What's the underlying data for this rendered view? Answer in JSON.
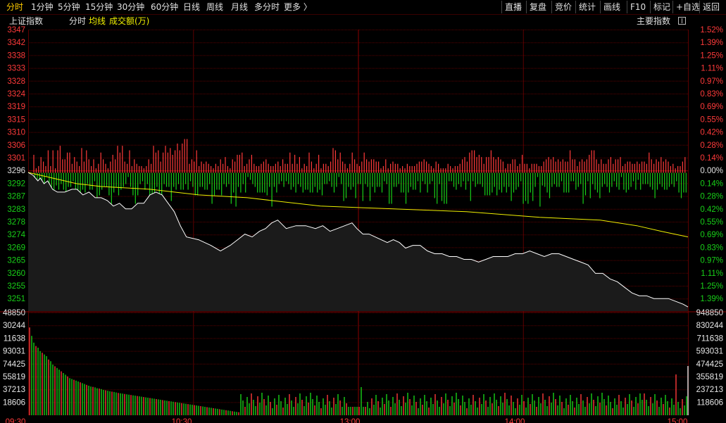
{
  "top_tabs": [
    "分时",
    "1分钟",
    "5分钟",
    "15分钟",
    "30分钟",
    "60分钟",
    "日线",
    "周线",
    "月线",
    "多分时",
    "更多 〉"
  ],
  "active_tab": "分时",
  "right_tabs": [
    "直播",
    "复盘",
    "竞价",
    "统计",
    "画线",
    "F10",
    "标记",
    "+自选",
    "返回"
  ],
  "info": {
    "index_name": "上证指数",
    "mode": "分时",
    "avg_label": "均线",
    "volume_label": "成交额(万)",
    "panel_label": "主要指数"
  },
  "colors": {
    "up": "#ff3a3a",
    "down": "#18d018",
    "flat": "#e0e0e0",
    "avg": "#f0f000",
    "grid": "#5a0000",
    "price": "#ffffff"
  },
  "price_axis": {
    "left_labels": [
      "3347",
      "3342",
      "3338",
      "3333",
      "3328",
      "3324",
      "3319",
      "3315",
      "3310",
      "3306",
      "3301",
      "3296",
      "3292",
      "3287",
      "3283",
      "3278",
      "3274",
      "3269",
      "3265",
      "3260",
      "3255",
      "3251"
    ],
    "right_labels": [
      "1.52%",
      "1.39%",
      "1.25%",
      "1.11%",
      "0.97%",
      "0.83%",
      "0.69%",
      "0.55%",
      "0.42%",
      "0.28%",
      "0.14%",
      "0.00%",
      "0.14%",
      "0.28%",
      "0.42%",
      "0.55%",
      "0.69%",
      "0.83%",
      "0.97%",
      "1.11%",
      "1.25%",
      "1.39%"
    ]
  },
  "volume_axis": {
    "left_labels": [
      "48850",
      "30244",
      "11638",
      "93031",
      "74425",
      "55819",
      "37213",
      "18606"
    ],
    "right_labels": [
      "948850",
      "830244",
      "711638",
      "593031",
      "474425",
      "355819",
      "237213",
      "118606"
    ]
  },
  "time_labels": [
    "09:30",
    "10:30",
    "13:00",
    "14:00",
    "15:00"
  ],
  "chart_data": {
    "type": "line",
    "title": "上证指数",
    "prev_close": 3296,
    "ylim": [
      3251,
      3347
    ],
    "price_points": [
      [
        0,
        3296
      ],
      [
        4,
        3295
      ],
      [
        8,
        3293
      ],
      [
        10,
        3294
      ],
      [
        13,
        3292
      ],
      [
        16,
        3293
      ],
      [
        20,
        3290
      ],
      [
        24,
        3289
      ],
      [
        30,
        3289
      ],
      [
        36,
        3290
      ],
      [
        40,
        3290
      ],
      [
        45,
        3288
      ],
      [
        50,
        3289
      ],
      [
        55,
        3287
      ],
      [
        60,
        3287
      ],
      [
        65,
        3286
      ],
      [
        70,
        3284
      ],
      [
        75,
        3285
      ],
      [
        80,
        3283
      ],
      [
        85,
        3283
      ],
      [
        90,
        3285
      ],
      [
        95,
        3285
      ],
      [
        100,
        3288
      ],
      [
        105,
        3289
      ],
      [
        110,
        3288
      ],
      [
        115,
        3285
      ],
      [
        120,
        3282
      ],
      [
        125,
        3277
      ],
      [
        130,
        3273
      ],
      [
        140,
        3272
      ],
      [
        150,
        3270
      ],
      [
        158,
        3268
      ],
      [
        166,
        3270
      ],
      [
        172,
        3272
      ],
      [
        178,
        3274
      ],
      [
        184,
        3273
      ],
      [
        190,
        3275
      ],
      [
        195,
        3276
      ],
      [
        200,
        3278
      ],
      [
        205,
        3279
      ],
      [
        212,
        3276
      ],
      [
        220,
        3277
      ],
      [
        228,
        3277
      ],
      [
        236,
        3276
      ],
      [
        242,
        3277
      ],
      [
        248,
        3275
      ],
      [
        254,
        3276
      ],
      [
        260,
        3277
      ],
      [
        266,
        3278
      ],
      [
        270,
        3276
      ],
      [
        275,
        3274
      ],
      [
        280,
        3274
      ],
      [
        285,
        3273
      ],
      [
        290,
        3272
      ],
      [
        295,
        3271
      ],
      [
        300,
        3272
      ],
      [
        305,
        3271
      ],
      [
        310,
        3269
      ],
      [
        316,
        3270
      ],
      [
        322,
        3270
      ],
      [
        328,
        3268
      ],
      [
        334,
        3267
      ],
      [
        340,
        3267
      ],
      [
        346,
        3266
      ],
      [
        352,
        3266
      ],
      [
        358,
        3265
      ],
      [
        364,
        3265
      ],
      [
        370,
        3264
      ],
      [
        376,
        3265
      ],
      [
        382,
        3266
      ],
      [
        388,
        3266
      ],
      [
        394,
        3266
      ],
      [
        400,
        3267
      ],
      [
        406,
        3267
      ],
      [
        412,
        3268
      ],
      [
        418,
        3267
      ],
      [
        424,
        3266
      ],
      [
        430,
        3267
      ],
      [
        436,
        3267
      ],
      [
        442,
        3266
      ],
      [
        448,
        3265
      ],
      [
        454,
        3264
      ],
      [
        460,
        3263
      ],
      [
        466,
        3260
      ],
      [
        472,
        3260
      ],
      [
        478,
        3258
      ],
      [
        484,
        3257
      ],
      [
        490,
        3255
      ],
      [
        496,
        3253
      ],
      [
        502,
        3252
      ],
      [
        508,
        3252
      ],
      [
        514,
        3251
      ],
      [
        520,
        3251
      ],
      [
        526,
        3251
      ],
      [
        532,
        3250
      ],
      [
        538,
        3249
      ],
      [
        542,
        3248
      ]
    ],
    "avg_points": [
      [
        0,
        3296
      ],
      [
        20,
        3294
      ],
      [
        40,
        3292
      ],
      [
        60,
        3291
      ],
      [
        100,
        3290
      ],
      [
        140,
        3288
      ],
      [
        180,
        3287
      ],
      [
        240,
        3284
      ],
      [
        300,
        3283
      ],
      [
        360,
        3282
      ],
      [
        420,
        3280
      ],
      [
        470,
        3279
      ],
      [
        500,
        3277
      ],
      [
        520,
        3275
      ],
      [
        542,
        3273
      ]
    ],
    "breadth_bars_top": [
      8,
      2,
      3,
      7,
      5,
      3,
      10,
      3,
      10,
      2,
      10,
      12,
      6,
      6,
      9,
      9,
      4,
      7,
      5,
      3,
      11,
      5,
      10,
      6,
      3,
      6,
      2,
      4,
      9,
      6,
      4,
      2,
      5,
      8,
      6,
      12,
      9,
      12,
      5,
      4,
      10,
      3,
      6,
      4,
      3,
      3,
      2,
      3,
      6,
      4,
      12,
      9,
      10,
      5,
      9,
      12,
      9,
      11,
      8,
      10,
      13,
      10,
      13,
      15,
      15,
      4,
      6,
      5,
      10,
      3,
      5,
      4,
      5,
      4,
      3,
      2,
      4,
      3,
      6,
      4,
      7,
      3,
      2,
      6,
      5,
      8,
      8,
      9,
      3,
      4,
      6,
      8,
      4,
      3,
      3,
      4,
      5,
      6,
      4,
      3,
      3,
      4,
      5,
      3,
      6,
      4,
      4,
      9,
      4,
      8,
      4,
      7,
      2,
      4,
      3,
      9,
      5,
      2,
      4,
      8,
      2,
      4,
      4,
      3,
      5,
      11,
      10,
      6,
      9,
      5,
      4,
      2,
      4,
      9,
      6,
      4,
      3,
      5,
      9,
      6,
      5,
      6,
      6,
      5,
      5,
      2,
      3,
      6,
      2,
      4,
      5,
      4,
      4,
      2,
      3,
      2,
      4,
      3,
      3,
      3,
      4,
      5,
      5,
      6,
      5,
      4,
      3,
      2,
      5,
      4,
      2,
      2,
      2,
      4,
      3,
      2,
      3,
      3,
      4,
      6,
      7,
      5,
      9,
      10,
      10,
      7,
      8,
      7,
      4,
      7,
      7,
      10,
      7,
      6,
      7,
      6,
      5,
      2,
      4,
      4,
      6,
      6,
      3,
      4,
      8,
      4,
      4,
      2,
      4,
      4,
      4,
      3,
      3,
      5,
      6,
      7,
      6,
      7,
      5,
      6,
      5,
      6,
      5,
      5,
      10,
      6,
      6,
      3,
      5,
      6,
      5,
      6,
      8,
      10,
      10,
      6,
      4,
      6,
      4,
      4,
      6,
      7,
      4,
      6,
      6,
      7,
      3,
      4,
      5,
      5,
      4,
      4,
      5,
      4,
      5,
      5,
      4,
      9,
      6,
      4,
      6,
      5,
      7,
      5,
      6,
      5,
      3,
      4,
      2,
      3,
      3,
      5,
      7,
      12,
      2,
      6,
      4,
      2,
      4,
      3,
      4,
      4,
      2,
      3
    ],
    "vol_values": [
      520,
      470,
      430,
      410,
      400,
      380,
      370,
      360,
      350,
      330,
      320,
      300,
      290,
      280,
      270,
      260,
      250,
      240,
      230,
      220,
      215,
      210,
      205,
      200,
      195,
      190,
      185,
      180,
      175,
      170,
      168,
      165,
      160,
      158,
      155,
      150,
      148,
      145,
      142,
      140,
      138,
      135,
      132,
      130,
      128,
      126,
      124,
      122,
      120,
      118,
      116,
      114,
      112,
      110,
      108,
      106,
      104,
      102,
      100,
      98,
      96,
      94,
      92,
      90,
      88,
      86,
      84,
      82,
      80,
      78,
      76,
      74,
      72,
      70,
      68,
      66,
      64,
      62,
      60,
      58,
      56,
      54,
      52,
      50,
      48,
      46,
      44,
      42,
      40,
      38,
      36,
      34,
      32,
      30,
      28,
      26,
      24,
      22,
      20,
      18
    ]
  }
}
